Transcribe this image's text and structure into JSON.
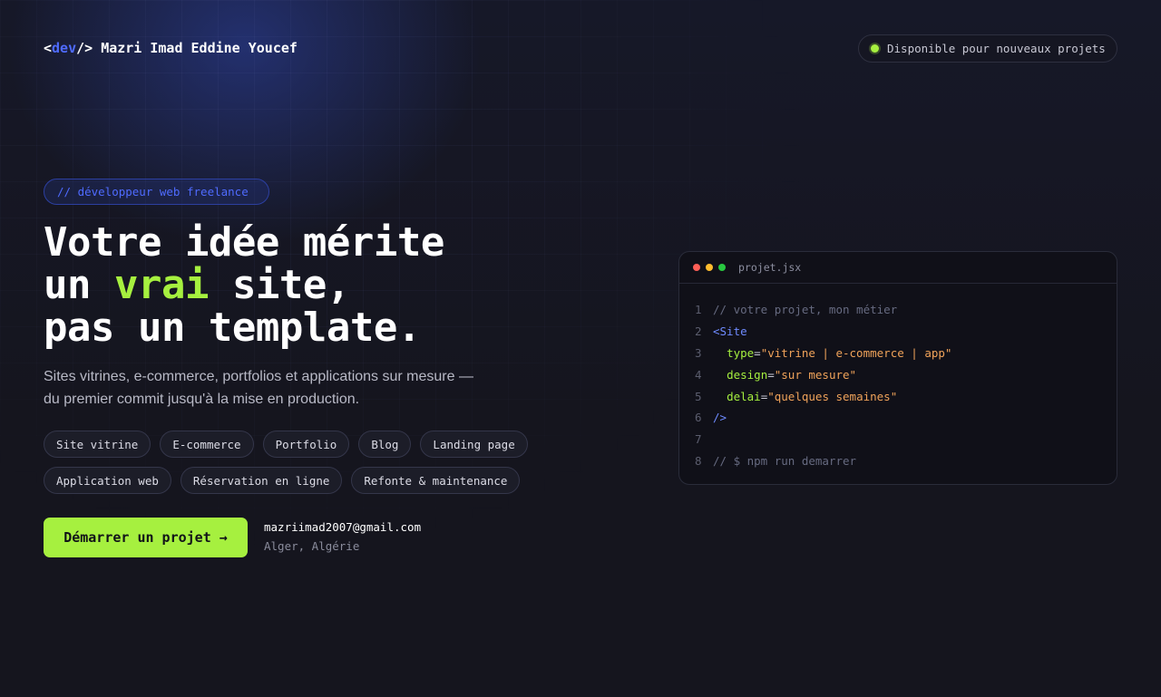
{
  "header": {
    "logo_open": "<",
    "logo_accent": "dev",
    "logo_close": "/>",
    "logo_name": "Mazri Imad Eddine Youcef",
    "status_text": "Disponible pour nouveaux projets"
  },
  "hero": {
    "tag": "// développeur web freelance",
    "headline_line1": "Votre idée mérite",
    "headline_line2_pre": "un ",
    "headline_line2_highlight": "vrai",
    "headline_line2_post": " site,",
    "headline_line3": "pas un template.",
    "subline": "Sites vitrines, e-commerce, portfolios et applications sur mesure — du premier commit jusqu'à la mise en production.",
    "services": [
      "Site vitrine",
      "E-commerce",
      "Portfolio",
      "Blog",
      "Landing page",
      "Application web",
      "Réservation en ligne",
      "Refonte & maintenance"
    ],
    "cta_label": "Démarrer un projet →",
    "email": "mazriimad2007@gmail.com",
    "location": "Alger, Algérie"
  },
  "code_window": {
    "filename": "projet.jsx",
    "lines": [
      {
        "n": "1",
        "comment": "// votre projet, mon métier"
      },
      {
        "n": "2",
        "tag": "<Site"
      },
      {
        "n": "3",
        "indent": "  ",
        "attr": "type",
        "eq": "=",
        "value": "\"vitrine | e-commerce | app\""
      },
      {
        "n": "4",
        "indent": "  ",
        "attr": "design",
        "eq": "=",
        "value": "\"sur mesure\""
      },
      {
        "n": "5",
        "indent": "  ",
        "attr": "delai",
        "eq": "=",
        "value": "\"quelques semaines\""
      },
      {
        "n": "6",
        "tag": "/>"
      },
      {
        "n": "7"
      },
      {
        "n": "8",
        "comment": "// $ npm run demarrer"
      }
    ]
  },
  "colors": {
    "background": "#15151e",
    "accent_blue": "#4f6bff",
    "accent_green": "#a6f03f",
    "string_orange": "#f0a35a"
  }
}
